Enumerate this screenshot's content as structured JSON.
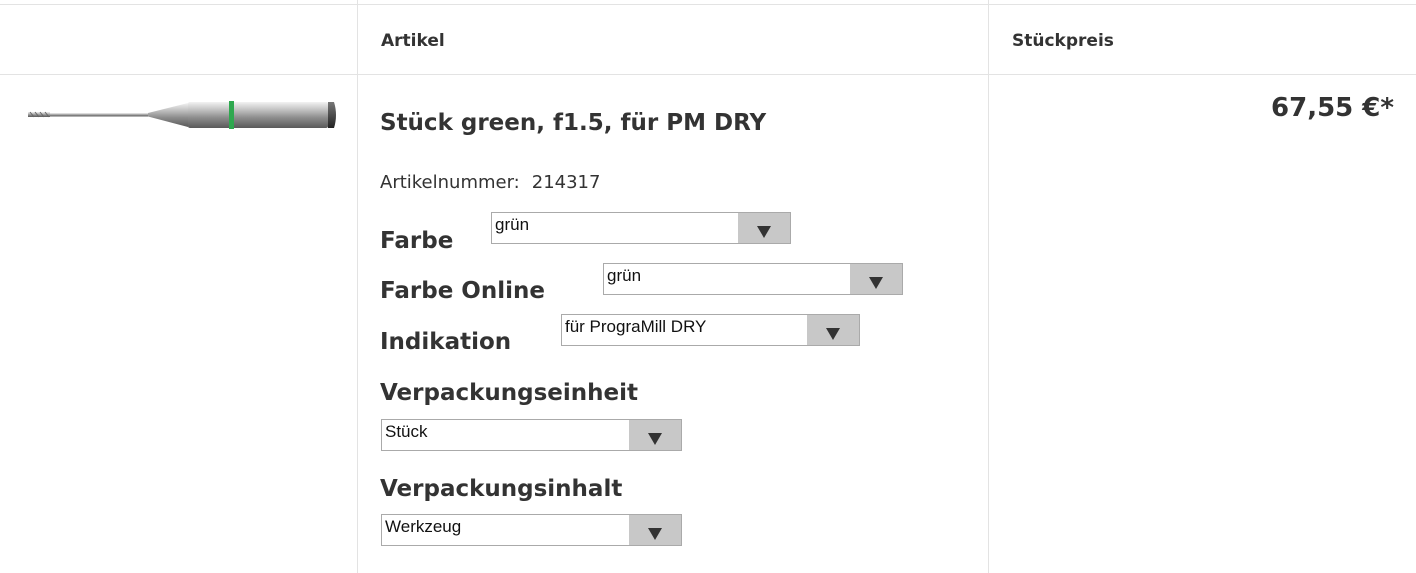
{
  "table": {
    "headers": {
      "image": "",
      "article": "Artikel",
      "unit_price": "Stückpreis"
    }
  },
  "product": {
    "image_icon": "milling-tool-image",
    "accent_ring_color": "#2fa84f",
    "title": "Stück green, f1.5, für PM DRY",
    "article_number_label": "Artikelnummer:",
    "article_number": "214317",
    "price": "67,55 €*",
    "properties": {
      "farbe": {
        "label": "Farbe",
        "value": "grün"
      },
      "farbe_online": {
        "label": "Farbe Online",
        "value": "grün"
      },
      "indikation": {
        "label": "Indikation",
        "value": "für PrograMill DRY"
      },
      "verpackungseinheit": {
        "label": "Verpackungseinheit",
        "value": "Stück"
      },
      "verpackungsinhalt": {
        "label": "Verpackungsinhalt",
        "value": "Werkzeug"
      }
    }
  }
}
